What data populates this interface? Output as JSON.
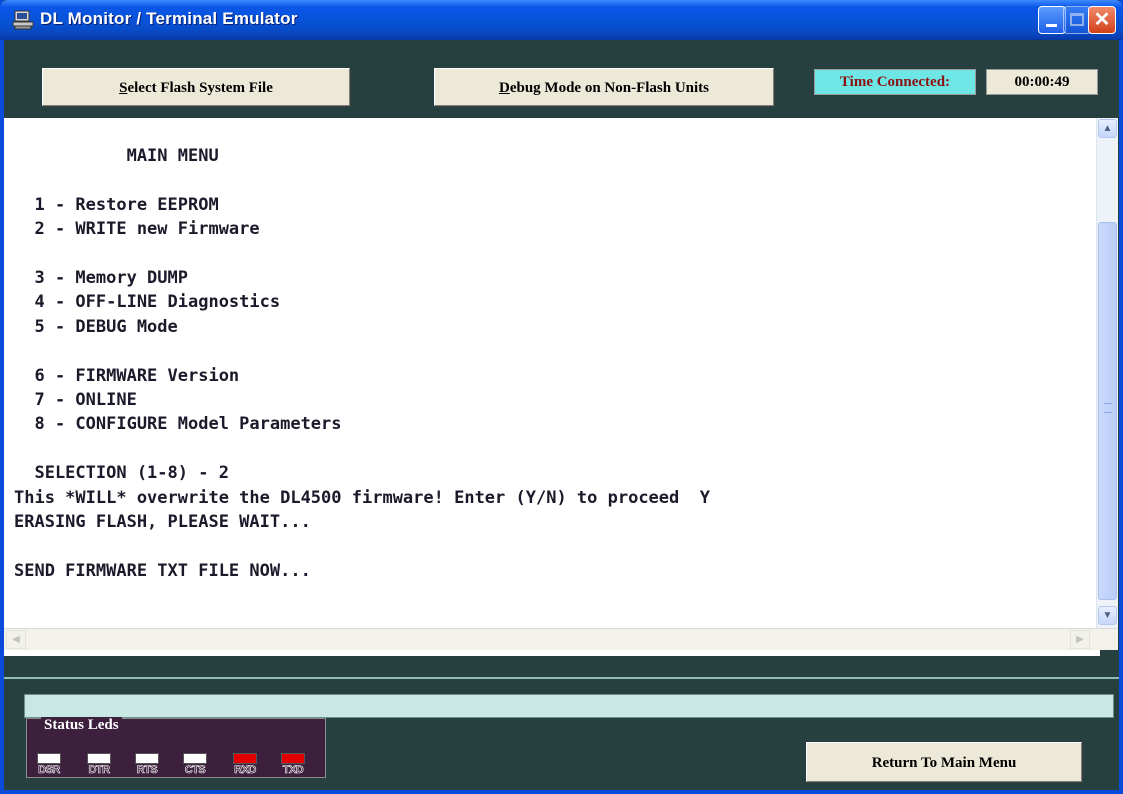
{
  "window": {
    "title": "DL Monitor / Terminal Emulator"
  },
  "toolbar": {
    "flash_button": {
      "first": "S",
      "rest": "elect Flash System File"
    },
    "debug_button": {
      "first": "D",
      "rest": "ebug Mode on Non-Flash Units"
    },
    "time_connected_label": "Time Connected:",
    "time_connected_value": "00:00:49"
  },
  "terminal": {
    "text": "           MAIN MENU\n\n  1 - Restore EEPROM\n  2 - WRITE new Firmware\n\n  3 - Memory DUMP\n  4 - OFF-LINE Diagnostics\n  5 - DEBUG Mode\n\n  6 - FIRMWARE Version\n  7 - ONLINE\n  8 - CONFIGURE Model Parameters\n\n  SELECTION (1-8) - 2\nThis *WILL* overwrite the DL4500 firmware! Enter (Y/N) to proceed  Y\nERASING FLASH, PLEASE WAIT...\n\nSEND FIRMWARE TXT FILE NOW..."
  },
  "status_leds": {
    "title": "Status Leds",
    "leds": [
      {
        "label": "DSR",
        "state": "white"
      },
      {
        "label": "DTR",
        "state": "white"
      },
      {
        "label": "RTS",
        "state": "white"
      },
      {
        "label": "CTS",
        "state": "white"
      },
      {
        "label": "RXD",
        "state": "red"
      },
      {
        "label": "TXD",
        "state": "red"
      }
    ]
  },
  "footer": {
    "return_button": "Return To Main Menu"
  },
  "colors": {
    "window_background": "#26403F",
    "time_label_background": "#6FE6E6",
    "time_label_text": "#8B1010",
    "led_red": "#E00000",
    "status_bar": "#C9E8E3"
  },
  "icons": {
    "app": "computer-terminal-icon",
    "minimize": "minimize-icon",
    "maximize": "maximize-icon",
    "close": "close-icon",
    "scroll_up": "arrow-up-icon",
    "scroll_down": "arrow-down-icon",
    "scroll_left": "arrow-left-icon",
    "scroll_right": "arrow-right-icon"
  }
}
